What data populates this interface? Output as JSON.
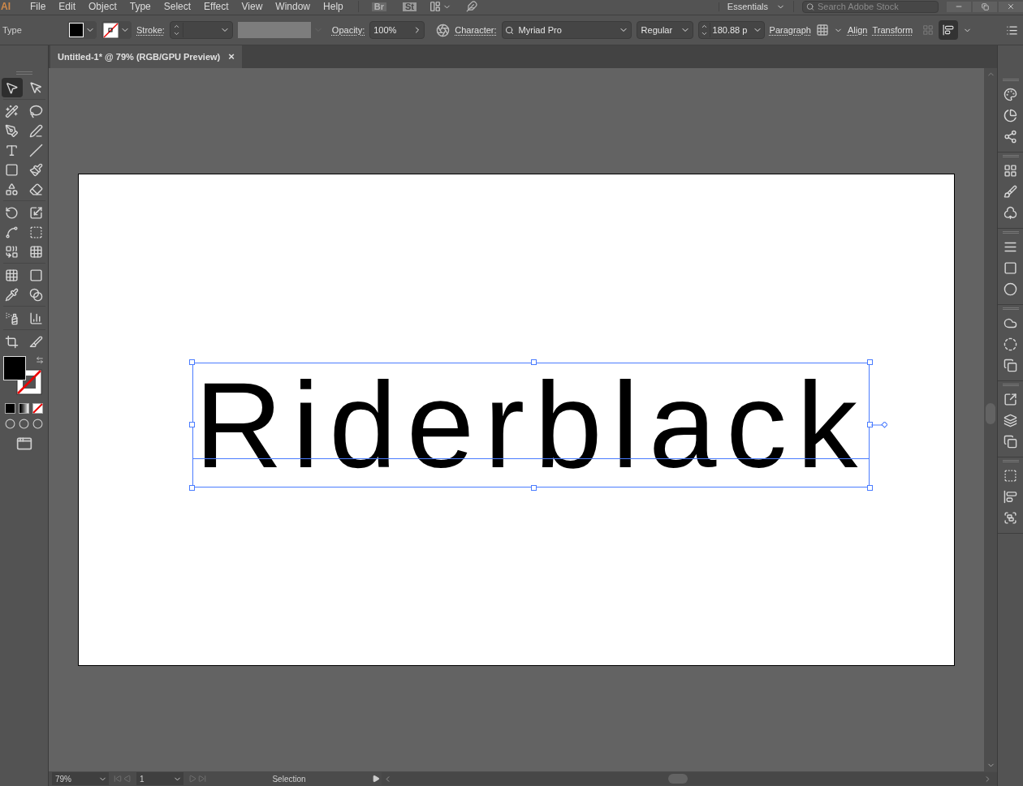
{
  "menu_bar": {
    "logo": "AI",
    "items": [
      "File",
      "Edit",
      "Object",
      "Type",
      "Select",
      "Effect",
      "View",
      "Window",
      "Help"
    ],
    "bridge_badge": "Br",
    "stock_badge": "St",
    "workspace": "Essentials",
    "search": {
      "placeholder": "Search Adobe Stock"
    }
  },
  "control_bar": {
    "selection_label": "Type",
    "stroke_label": "Stroke:",
    "opacity_label": "Opacity:",
    "opacity_value": "100%",
    "character_label": "Character:",
    "font_family": "Myriad Pro",
    "font_style": "Regular",
    "font_size": "180.88 p",
    "paragraph_label": "Paragraph",
    "align_label": "Align",
    "transform_label": "Transform"
  },
  "document_tab": {
    "title": "Untitled-1* @ 79% (RGB/GPU Preview)",
    "close": "×"
  },
  "tools": [
    {
      "selected": true
    },
    {
      "selected": false
    },
    {
      "selected": false
    },
    {
      "selected": false
    },
    {
      "selected": false
    },
    {
      "selected": false
    },
    {
      "selected": false
    },
    {
      "selected": false
    },
    {
      "selected": false
    },
    {
      "selected": false
    },
    {
      "selected": false
    },
    {
      "selected": false
    },
    {
      "selected": false
    },
    {
      "selected": false
    },
    {
      "selected": false
    },
    {
      "selected": false
    },
    {
      "selected": false
    },
    {
      "selected": false
    },
    {
      "selected": false
    },
    {
      "selected": false
    },
    {
      "selected": false
    },
    {
      "selected": false
    },
    {
      "selected": false
    },
    {
      "selected": false
    },
    {
      "selected": false
    },
    {
      "selected": false
    }
  ],
  "artboard": {
    "text_object": {
      "text": "Riderblack",
      "selected": true
    }
  },
  "status_bar": {
    "zoom": "79%",
    "artboard_number": "1",
    "current_tool": "Selection"
  }
}
